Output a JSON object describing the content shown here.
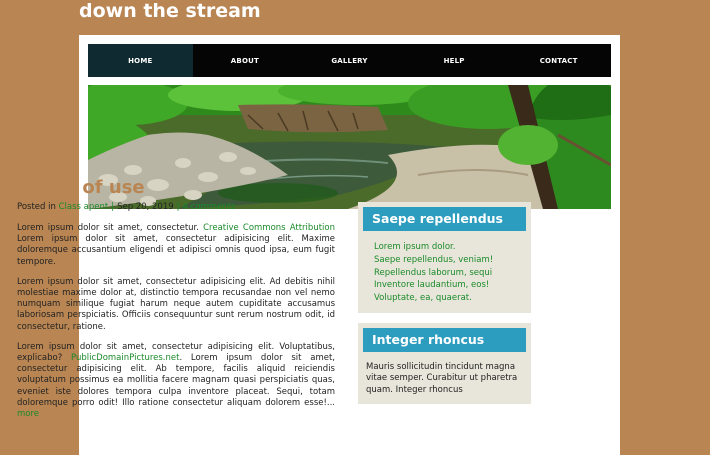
{
  "site": {
    "title": "down the stream"
  },
  "nav": {
    "items": [
      {
        "label": "HOME",
        "active": true
      },
      {
        "label": "ABOUT",
        "active": false
      },
      {
        "label": "GALLERY",
        "active": false
      },
      {
        "label": "HELP",
        "active": false
      },
      {
        "label": "CONTACT",
        "active": false
      }
    ]
  },
  "post": {
    "title": "terms of use",
    "meta": {
      "posted_in": "Posted in",
      "category": "Class apent",
      "date": "Sep 20, 2019",
      "comments": "4 comments"
    },
    "paragraphs": [
      {
        "lead": "Lorem ipsum dolor sit amet, consectetur.",
        "link": "Creative Commons Attribution",
        "rest": "Lorem ipsum dolor sit amet, consectetur adipisicing elit. Maxime doloremque accusantium eligendi et adipisci omnis quod ipsa, eum fugit tempore."
      },
      {
        "text": "Lorem ipsum dolor sit amet, consectetur adipisicing elit. Ad debitis nihil molestiae maxime dolor at, distinctio tempora recusandae non vel nemo numquam similique fugiat harum neque autem cupiditate accusamus laboriosam perspiciatis. Officiis consequuntur sunt rerum nostrum odit, id consectetur, ratione."
      },
      {
        "lead": "Lorem ipsum dolor sit amet, consectetur adipisicing elit. Voluptatibus, explicabo?",
        "link": "PublicDomainPictures.net",
        "rest": ". Lorem ipsum dolor sit amet, consectetur adipisicing elit. Ab tempore, facilis aliquid reiciendis voluptatum possimus ea mollitia facere magnam quasi perspiciatis quas, eveniet iste dolores tempora culpa inventore placeat. Sequi, totam doloremque porro odit! Illo ratione consectetur aliquam dolorem esse!...",
        "more": "more"
      }
    ]
  },
  "sidebar": {
    "widget1": {
      "title": "Saepe repellendus",
      "items": [
        "Lorem ipsum dolor.",
        "Saepe repellendus, veniam!",
        "Repellendus laborum, sequi",
        "Inventore laudantium, eos!",
        "Voluptate, ea, quaerat."
      ]
    },
    "widget2": {
      "title": "Integer rhoncus",
      "text": "Mauris sollicitudin tincidunt magna vitae semper. Curabitur ut pharetra quam. Integer rhoncus"
    }
  },
  "colors": {
    "background": "#b98552",
    "nav": "#050505",
    "nav_active": "#0f2a30",
    "link": "#1a8a2a",
    "widget_title": "#2d9dbf",
    "widget_bg": "#e8e6da"
  }
}
